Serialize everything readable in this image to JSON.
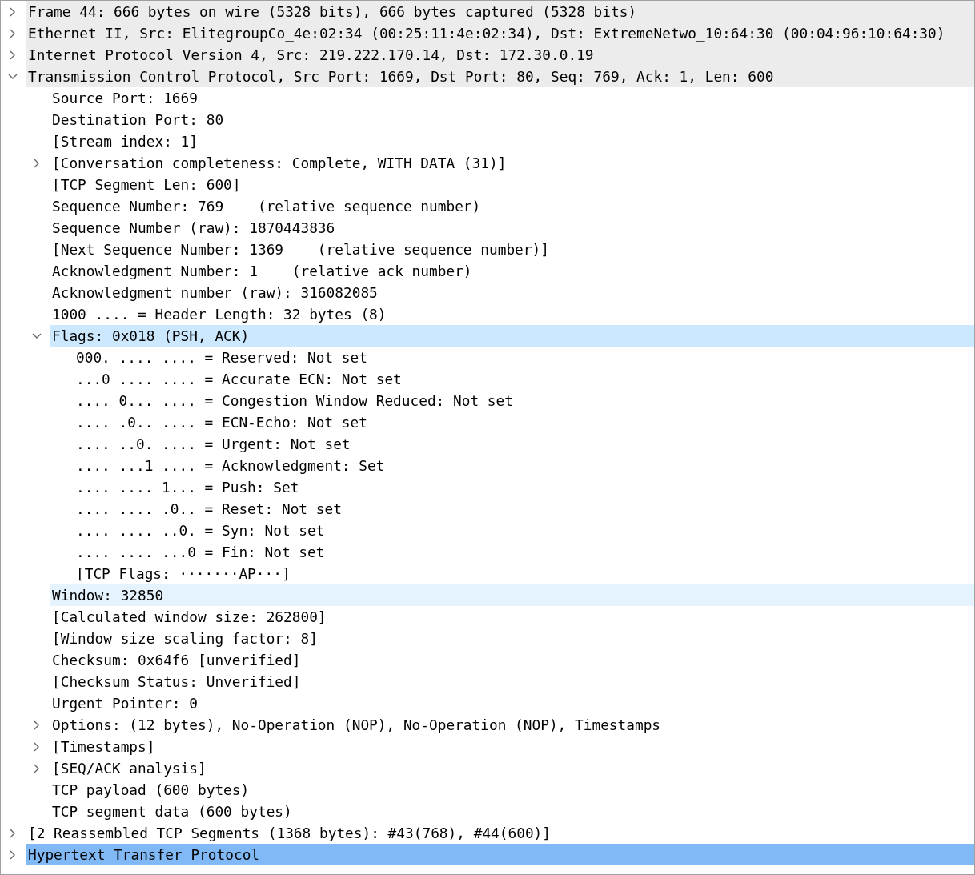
{
  "tree": [
    {
      "label": "Frame 44: 666 bytes on wire (5328 bits), 666 bytes captured (5328 bits)",
      "expanded": false,
      "selected": false,
      "shaded": true
    },
    {
      "label": "Ethernet II, Src: ElitegroupCo_4e:02:34 (00:25:11:4e:02:34), Dst: ExtremeNetwo_10:64:30 (00:04:96:10:64:30)",
      "expanded": false,
      "selected": false,
      "shaded": true
    },
    {
      "label": "Internet Protocol Version 4, Src: 219.222.170.14, Dst: 172.30.0.19",
      "expanded": false,
      "selected": false,
      "shaded": true
    },
    {
      "label": "Transmission Control Protocol, Src Port: 1669, Dst Port: 80, Seq: 769, Ack: 1, Len: 600",
      "expanded": true,
      "selected": false,
      "shaded": true,
      "children": [
        {
          "label": "Source Port: 1669",
          "selected": false
        },
        {
          "label": "Destination Port: 80",
          "selected": false
        },
        {
          "label": "[Stream index: 1]",
          "selected": false
        },
        {
          "label": "[Conversation completeness: Complete, WITH_DATA (31)]",
          "expanded": false,
          "selected": false
        },
        {
          "label": "[TCP Segment Len: 600]",
          "selected": false
        },
        {
          "label": "Sequence Number: 769    (relative sequence number)",
          "selected": false
        },
        {
          "label": "Sequence Number (raw): 1870443836",
          "selected": false
        },
        {
          "label": "[Next Sequence Number: 1369    (relative sequence number)]",
          "selected": false
        },
        {
          "label": "Acknowledgment Number: 1    (relative ack number)",
          "selected": false
        },
        {
          "label": "Acknowledgment number (raw): 316082085",
          "selected": false
        },
        {
          "label": "1000 .... = Header Length: 32 bytes (8)",
          "selected": false
        },
        {
          "label": "Flags: 0x018 (PSH, ACK)",
          "expanded": true,
          "selected": false,
          "hovered": true,
          "children": [
            {
              "label": "000. .... .... = Reserved: Not set",
              "selected": false
            },
            {
              "label": "...0 .... .... = Accurate ECN: Not set",
              "selected": false
            },
            {
              "label": ".... 0... .... = Congestion Window Reduced: Not set",
              "selected": false
            },
            {
              "label": ".... .0.. .... = ECN-Echo: Not set",
              "selected": false
            },
            {
              "label": ".... ..0. .... = Urgent: Not set",
              "selected": false
            },
            {
              "label": ".... ...1 .... = Acknowledgment: Set",
              "selected": false
            },
            {
              "label": ".... .... 1... = Push: Set",
              "selected": false
            },
            {
              "label": ".... .... .0.. = Reset: Not set",
              "selected": false
            },
            {
              "label": ".... .... ..0. = Syn: Not set",
              "selected": false
            },
            {
              "label": ".... .... ...0 = Fin: Not set",
              "selected": false
            },
            {
              "label": "[TCP Flags: ·······AP···]",
              "selected": false
            }
          ]
        },
        {
          "label": "Window: 32850",
          "selected": false,
          "emphasized": true
        },
        {
          "label": "[Calculated window size: 262800]",
          "selected": false
        },
        {
          "label": "[Window size scaling factor: 8]",
          "selected": false
        },
        {
          "label": "Checksum: 0x64f6 [unverified]",
          "selected": false
        },
        {
          "label": "[Checksum Status: Unverified]",
          "selected": false
        },
        {
          "label": "Urgent Pointer: 0",
          "selected": false
        },
        {
          "label": "Options: (12 bytes), No-Operation (NOP), No-Operation (NOP), Timestamps",
          "expanded": false,
          "selected": false
        },
        {
          "label": "[Timestamps]",
          "expanded": false,
          "selected": false
        },
        {
          "label": "[SEQ/ACK analysis]",
          "expanded": false,
          "selected": false
        },
        {
          "label": "TCP payload (600 bytes)",
          "selected": false
        },
        {
          "label": "TCP segment data (600 bytes)",
          "selected": false
        }
      ]
    },
    {
      "label": "[2 Reassembled TCP Segments (1368 bytes): #43(768), #44(600)]",
      "expanded": false,
      "selected": false
    },
    {
      "label": "Hypertext Transfer Protocol",
      "expanded": false,
      "selected": true
    }
  ]
}
